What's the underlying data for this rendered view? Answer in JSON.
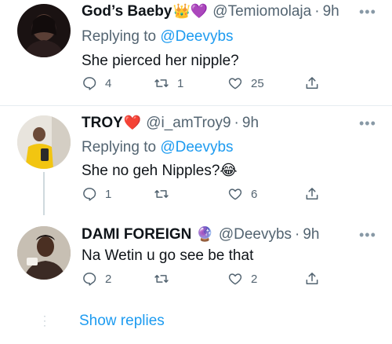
{
  "tweets": [
    {
      "name": "God’s Baeby",
      "emojis": "👑💜",
      "handle": "@Temiomolaja",
      "time": "9h",
      "replying_prefix": "Replying to ",
      "replying_to": "@Deevybs",
      "text": "She pierced her nipple?",
      "replies": "4",
      "retweets": "1",
      "likes": "25"
    },
    {
      "name": "TROY",
      "emojis": "❤️",
      "handle": "@i_amTroy9",
      "time": "9h",
      "replying_prefix": "Replying to ",
      "replying_to": "@Deevybs",
      "text": "She no geh Nipples?",
      "text_emoji": "😂",
      "replies": "1",
      "retweets": "",
      "likes": "6"
    },
    {
      "name": "DAMI FOREIGN",
      "emojis": "🔮",
      "handle": "@Deevybs",
      "time": "9h",
      "text": "Na Wetin u go see be that",
      "replies": "2",
      "retweets": "",
      "likes": "2"
    }
  ],
  "more_label": "•••",
  "show_replies": "Show replies",
  "colors": {
    "link": "#1d9bf0",
    "secondary": "#536471",
    "text": "#0f1419"
  }
}
